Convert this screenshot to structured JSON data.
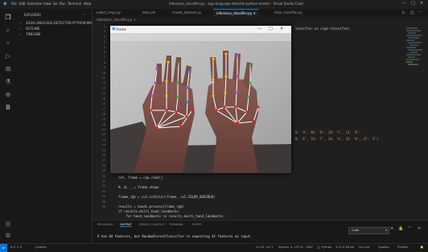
{
  "titlebar": {
    "menus": [
      "File",
      "Edit",
      "Selection",
      "View",
      "Go",
      "Run",
      "Terminal",
      "Help"
    ],
    "title": "inference_classifier.py - sign-language-detector-python-master - Visual Studio Code"
  },
  "sidebar": {
    "header": "EXPLORER",
    "sections": [
      "SIGN-LANGUAGE-DETECTOR-PYTHON-MA...",
      "OUTLINE",
      "TIMELINE"
    ]
  },
  "tabs": [
    "collect_imgs.py",
    "data.pkl",
    "create_dataset.py",
    "inference_classifier.py",
    "train_classifier.py"
  ],
  "active_tab": 3,
  "breadcrumb": "inference_classifier.py > ...",
  "editor": {
    "line_numbers": [
      "1",
      "2",
      "3",
      "4",
      "5",
      "6",
      "7",
      "8",
      "9",
      "10",
      "11",
      "12",
      "13",
      "14",
      "15",
      "16",
      "17",
      "18",
      "19",
      "20",
      "21",
      "22",
      "23",
      "24",
      "25",
      "26",
      "27",
      "28",
      "29",
      "30",
      "31",
      "32",
      "33",
      "34",
      "35",
      "36"
    ],
    "right_text_1": "lassifier as sign-classifier.",
    "right_text_2": "0: 'A', 86: 'B', 28: 'C', 13: 'D',",
    "right_text_3": "0: 'E', 33: 'F', 34: 'G', 35: 'H', 37: 'I'}",
    "code_lines": [
      "ret, frame = cap.read()",
      "",
      "H, W, _ = frame.shape",
      "",
      "frame_rgb = cv2.cvtColor(frame, cv2.COLOR_BGR2RGB)",
      "",
      "results = hands.process(frame_rgb)",
      "if results.multi_hand_landmarks:",
      "    for hand_landmarks in results.multi_hand_landmarks:"
    ]
  },
  "frame_window": {
    "title": "frame",
    "controls": [
      "—",
      "□",
      "✕"
    ]
  },
  "panel": {
    "tabs": [
      "PROBLEMS",
      "OUTPUT",
      "DEBUG CONSOLE",
      "TERMINAL",
      "PORTS"
    ],
    "active_tab": 1,
    "terminal_text": "X has 84 features, but RandomForestClassifier is expecting 42 features as input.",
    "select_value": "Code"
  },
  "statusbar": {
    "left": [
      "⊗ 0 ⚠ 0",
      "Quokka"
    ],
    "right": [
      "Ln 50, Col 1",
      "Spaces: 4",
      "UTF-8",
      "CRLF",
      "{} Python",
      "3.11.4 64-bit",
      "Go Live",
      "Quokka",
      "Prettier"
    ]
  },
  "colors": {
    "accent": "#0078d4",
    "landmark_red": "#e02020",
    "landmark_green": "#20c040",
    "landmark_purple": "#b050e0",
    "landmark_yellow": "#f0c000",
    "connector_white": "#ffffff"
  }
}
